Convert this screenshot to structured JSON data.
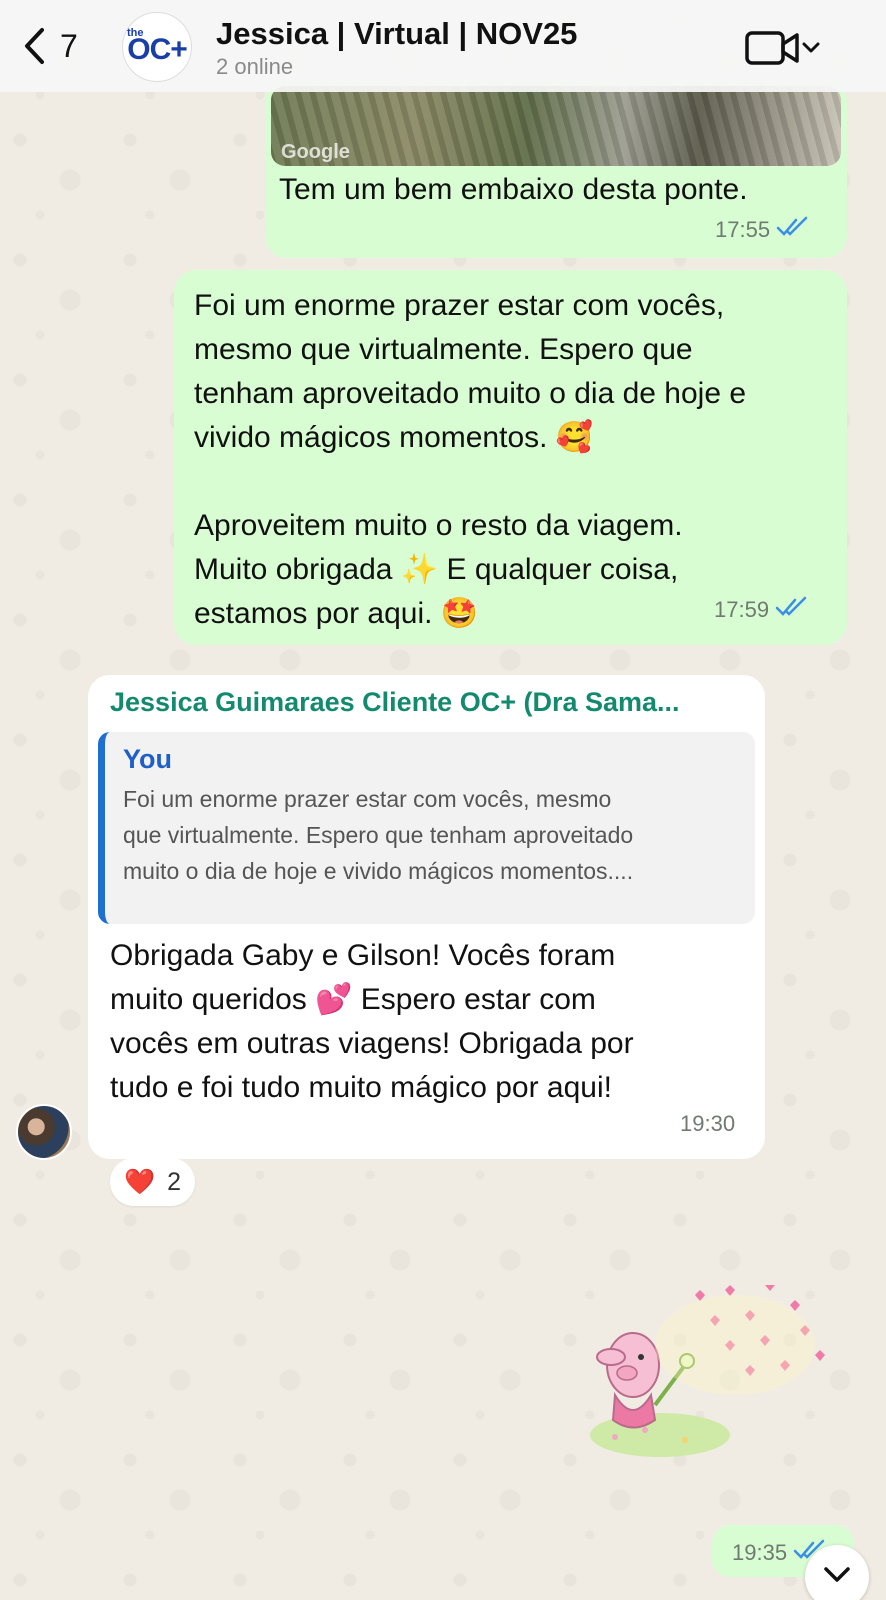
{
  "header": {
    "back_count": "7",
    "avatar_logo_small": "the",
    "avatar_logo_large": "OC+",
    "title": "Jessica | Virtual | NOV25",
    "status": "2 online",
    "video_icon": "video-camera-icon"
  },
  "messages": [
    {
      "type": "outgoing-location",
      "map_label": "Google",
      "text": "Tem um bem embaixo desta ponte.",
      "time": "17:55",
      "read_receipt": "double-check-blue"
    },
    {
      "type": "outgoing",
      "lines": [
        "Foi um enorme prazer estar com vocês,",
        "mesmo que virtualmente. Espero que",
        "tenham aproveitado muito o dia de hoje e",
        "vivido mágicos momentos. 🥰",
        "",
        "Aproveitem muito o resto da viagem.",
        "Muito obrigada ✨ E qualquer coisa,",
        "estamos por aqui. 🤩"
      ],
      "time": "17:59",
      "read_receipt": "double-check-blue"
    },
    {
      "type": "incoming-reply",
      "sender": "Jessica Guimaraes Cliente OC+ (Dra Sama...",
      "quote_author": "You",
      "quote_lines": [
        "Foi um enorme prazer estar com vocês, mesmo",
        "que virtualmente. Espero que tenham aproveitado",
        "muito o dia de hoje e vivido mágicos momentos...."
      ],
      "lines": [
        "Obrigada Gaby e Gilson! Vocês foram",
        "muito queridos 💕 Espero estar com",
        "vocês em outras viagens! Obrigada por",
        "tudo e foi tudo muito mágico por aqui!"
      ],
      "time": "19:30",
      "reaction_emoji": "❤️",
      "reaction_count": "2"
    },
    {
      "type": "outgoing-sticker",
      "sticker": "pink-piglet-blowing-hearts-sticker",
      "time": "19:35",
      "read_receipt": "double-check-blue"
    }
  ],
  "colors": {
    "outgoing_bubble": "#d9fdd3",
    "incoming_bubble": "#ffffff",
    "sender_name": "#138a6e",
    "quote_accent": "#1f6fd1",
    "read_receipt": "#3b8fe6"
  }
}
